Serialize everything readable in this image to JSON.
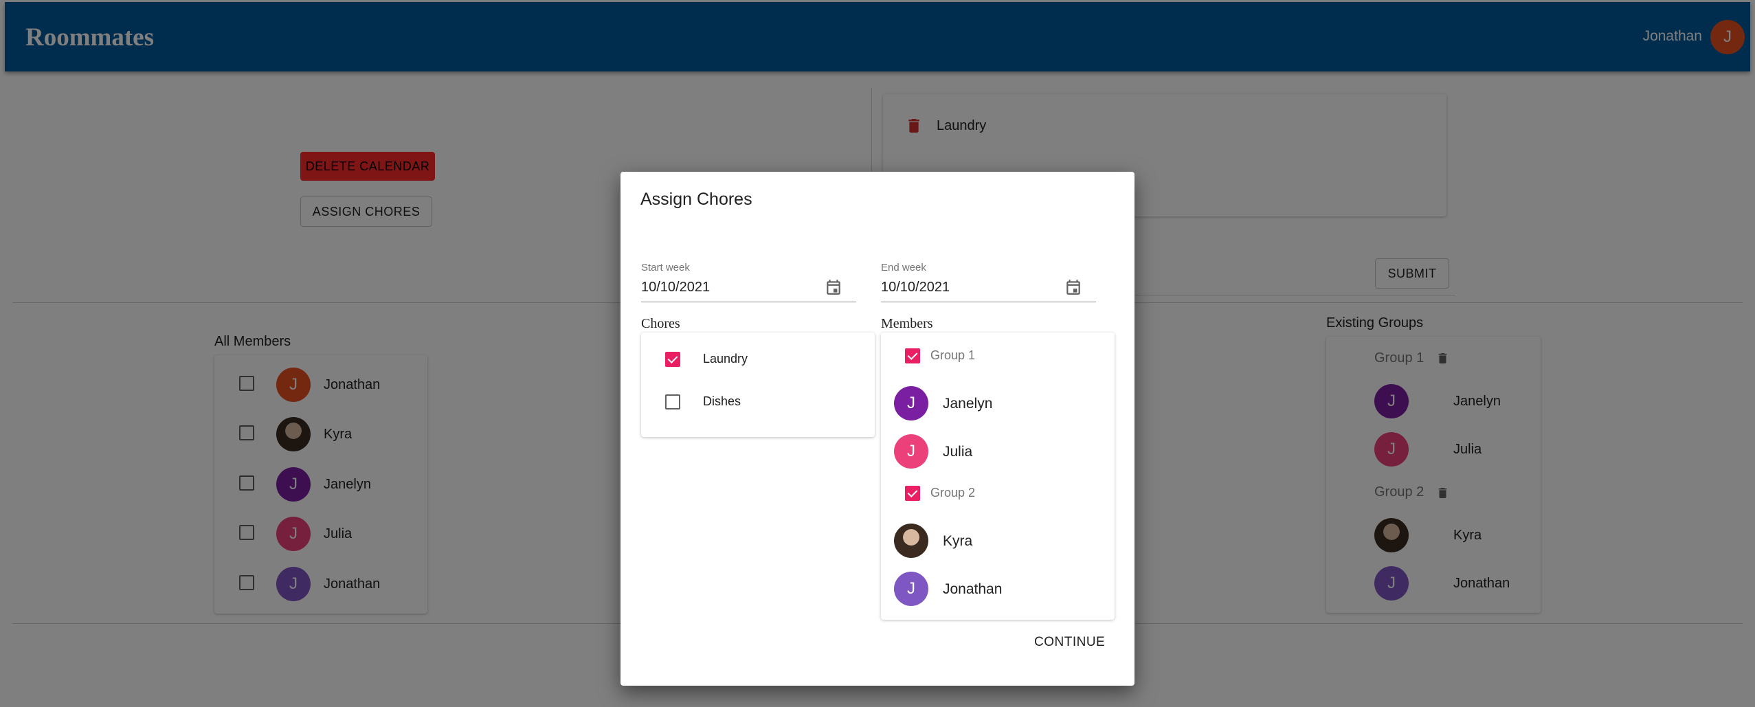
{
  "app": {
    "title": "Roommates",
    "user_name": "Jonathan",
    "user_initial": "J"
  },
  "actions": {
    "delete_calendar": "DELETE CALENDAR",
    "assign_chores": "ASSIGN CHORES"
  },
  "chores_panel": {
    "items": [
      {
        "label": "Laundry"
      }
    ],
    "submit": "SUBMIT"
  },
  "all_members": {
    "title": "All Members",
    "members": [
      {
        "name": "Jonathan",
        "initial": "J",
        "color": "#e8501f"
      },
      {
        "name": "Kyra",
        "initial": "",
        "color": "#6b4f3a"
      },
      {
        "name": "Janelyn",
        "initial": "J",
        "color": "#7b1fa2"
      },
      {
        "name": "Julia",
        "initial": "J",
        "color": "#ec407a"
      },
      {
        "name": "Jonathan",
        "initial": "J",
        "color": "#7e57c2"
      }
    ]
  },
  "existing_groups": {
    "title": "Existing Groups",
    "groups": [
      {
        "name": "Group 1",
        "members": [
          {
            "name": "Janelyn",
            "initial": "J",
            "color": "#7b1fa2"
          },
          {
            "name": "Julia",
            "initial": "J",
            "color": "#ec407a"
          }
        ]
      },
      {
        "name": "Group 2",
        "members": [
          {
            "name": "Kyra",
            "initial": "",
            "color": "#6b4f3a"
          },
          {
            "name": "Jonathan",
            "initial": "J",
            "color": "#7e57c2"
          }
        ]
      }
    ]
  },
  "dialog": {
    "title": "Assign Chores",
    "start_week": {
      "label": "Start week",
      "value": "10/10/2021"
    },
    "end_week": {
      "label": "End week",
      "value": "10/10/2021"
    },
    "chores_label": "Chores",
    "chores": [
      {
        "label": "Laundry",
        "checked": true
      },
      {
        "label": "Dishes",
        "checked": false
      }
    ],
    "members_label": "Members",
    "groups": [
      {
        "name": "Group 1",
        "checked": true,
        "members": [
          {
            "name": "Janelyn",
            "initial": "J",
            "color": "#7b1fa2"
          },
          {
            "name": "Julia",
            "initial": "J",
            "color": "#ec407a"
          }
        ]
      },
      {
        "name": "Group 2",
        "checked": true,
        "members": [
          {
            "name": "Kyra",
            "initial": "",
            "color": "#6b4f3a"
          },
          {
            "name": "Jonathan",
            "initial": "J",
            "color": "#7e57c2"
          }
        ]
      }
    ],
    "continue": "CONTINUE"
  },
  "colors": {
    "appbar": "#005a9c",
    "accent": "#e91e63",
    "delete_red": "#ff2a2a",
    "trash_red": "#d32f2f"
  }
}
